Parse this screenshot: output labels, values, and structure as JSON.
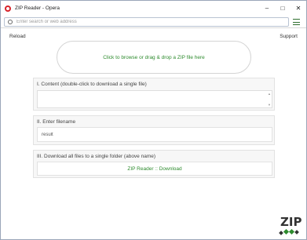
{
  "window": {
    "title": "ZIP Reader - Opera",
    "controls": {
      "minimize": "–",
      "maximize": "□",
      "close": "✕"
    }
  },
  "addressbar": {
    "placeholder": "Enter search or web address",
    "site_icon": "site-info-icon",
    "menu_icon": "easy-setup-icon"
  },
  "toolbar": {
    "reload_label": "Reload",
    "support_label": "Support"
  },
  "dropzone": {
    "label": "Click to browse or drag & drop a ZIP file here"
  },
  "panels": {
    "content": {
      "label": "I. Content (double-click to download a single file)"
    },
    "filename": {
      "label": "II. Enter filename",
      "value": "result"
    },
    "download": {
      "label": "III. Download all files to a single folder (above name)",
      "button_label": "ZIP Reader :: Download"
    }
  },
  "logo": {
    "text": "ZIP"
  },
  "colors": {
    "accent_green": "#2e8b2e",
    "opera_red": "#d8232a",
    "logo_dark": "#333333"
  }
}
